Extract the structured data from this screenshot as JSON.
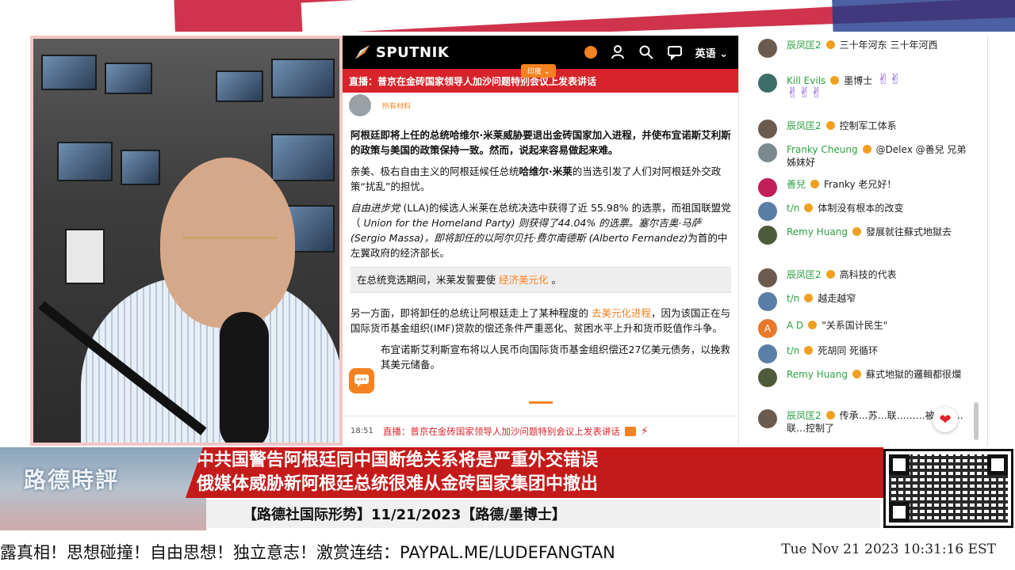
{
  "colors": {
    "brand_orange": "#f58220",
    "live_red": "#d8232a",
    "headline_red": "#c41a1a",
    "chat_name_green": "#2ea043"
  },
  "article": {
    "brand": "SPUTNIK",
    "language": "英语",
    "edition": "印度",
    "live_banner": "直播：普京在金砖国家领导人加沙问题特别会议上发表讲话",
    "author_label": "所有材料",
    "lead": "阿根廷即将上任的总统哈维尔·米莱威胁要退出金砖国家加入进程，并使布宜诺斯艾利斯的政策与美国的政策保持一致。然而，说起来容易做起来难。",
    "p1_a": "亲美、极右自由主义的阿根廷候任总统",
    "p1_b": "哈维尔·米莱",
    "p1_c": "的当选引发了人们对阿根廷外交政策“扰乱”的担忧。",
    "p2_a": "自由进步党",
    "p2_b": " (LLA)的候选人米莱在总统决选中获得了近 55.98% 的选票，而祖国联盟党（",
    "p2_c": " Union for the Homeland Party",
    "p2_d": ") 则获得了44.04% 的选票。塞尔吉奥·马萨 (Sergio Massa)",
    "p2_e": "，即将卸任的以阿尔贝托·费尔南德斯 (Alberto Fernandez)",
    "p2_f": "为首的中左翼政府的经济部长。",
    "quote_a": "在总统竞选期间，米莱发誓要使 ",
    "quote_link": "经济美元化",
    "quote_b": " 。",
    "p3_a": "另一方面，即将卸任的总统让阿根廷走上了某种程度的 ",
    "p3_link": "去美元化进程",
    "p3_b": "，因为该国正在与国际货币基金组织(IMF)贷款的偿还条件严重恶化、贫困水平上升和货币贬值作斗争。",
    "p4": "布宜诺斯艾利斯宣布将以人民币向国际货币基金组织偿还27亿美元债务，以挽救其美元储备。",
    "bottom_time": "18:51",
    "bottom_text": "直播：普京在金砖国家领导人加沙问题特别会议上发表讲话"
  },
  "chat": {
    "messages": [
      {
        "user": "辰凤匡2",
        "text": "三十年河东 三十年河西",
        "avatar": "#6b5b4e"
      },
      {
        "user": "Kill Evils",
        "text": "墨博士",
        "hands_inline": "✌✌",
        "hands_line": "✌✌✌",
        "avatar": "#3d6f6a"
      },
      {
        "user": "辰凤匡2",
        "text": "控制军工体系",
        "avatar": "#6b5b4e"
      },
      {
        "user": "Franky Cheung",
        "text": "@Delex @善兒 兄弟姊妹好",
        "avatar": "#7a8a8f"
      },
      {
        "user": "善兒",
        "text": "Franky 老兄好！",
        "avatar": "#c21f5a"
      },
      {
        "user": "t/n",
        "text": "体制没有根本的改变",
        "avatar": "#5b7ea8"
      },
      {
        "user": "Remy Huang",
        "text": "發展就往蘇式地獄去",
        "avatar": "#4f5a3a"
      },
      {
        "user": "辰凤匡2",
        "text": "高科技的代表",
        "avatar": "#6b5b4e"
      },
      {
        "user": "t/n",
        "text": "越走越窄",
        "avatar": "#5b7ea8"
      },
      {
        "user": "A D",
        "text": "\"关系国计民生\"",
        "avatar": "#e8782a",
        "initial": "A"
      },
      {
        "user": "t/n",
        "text": "死胡同 死循环",
        "avatar": "#5b7ea8"
      },
      {
        "user": "Remy Huang",
        "text": "蘇式地獄的邏輯都很爛",
        "avatar": "#4f5a3a"
      },
      {
        "user": "辰凤匡2",
        "text": "传承…苏…联………被…苏…联…控制了",
        "avatar": "#6b5b4e"
      }
    ]
  },
  "banner": {
    "logo": "路德時評",
    "headline_1": "中共国警告阿根廷同中国断绝关系将是严重外交错误",
    "headline_2": "俄媒体威胁新阿根廷总统很难从金砖国家集团中撤出",
    "subline": "【路德社国际形势】11/21/2023【路德/墨博士】"
  },
  "ticker": {
    "text": "露真相！思想碰撞！自由思想！独立意志！激赏连结：PAYPAL.ME/LUDEFANGTAN",
    "datetime": "Tue Nov 21 2023 10:31:16 EST"
  }
}
